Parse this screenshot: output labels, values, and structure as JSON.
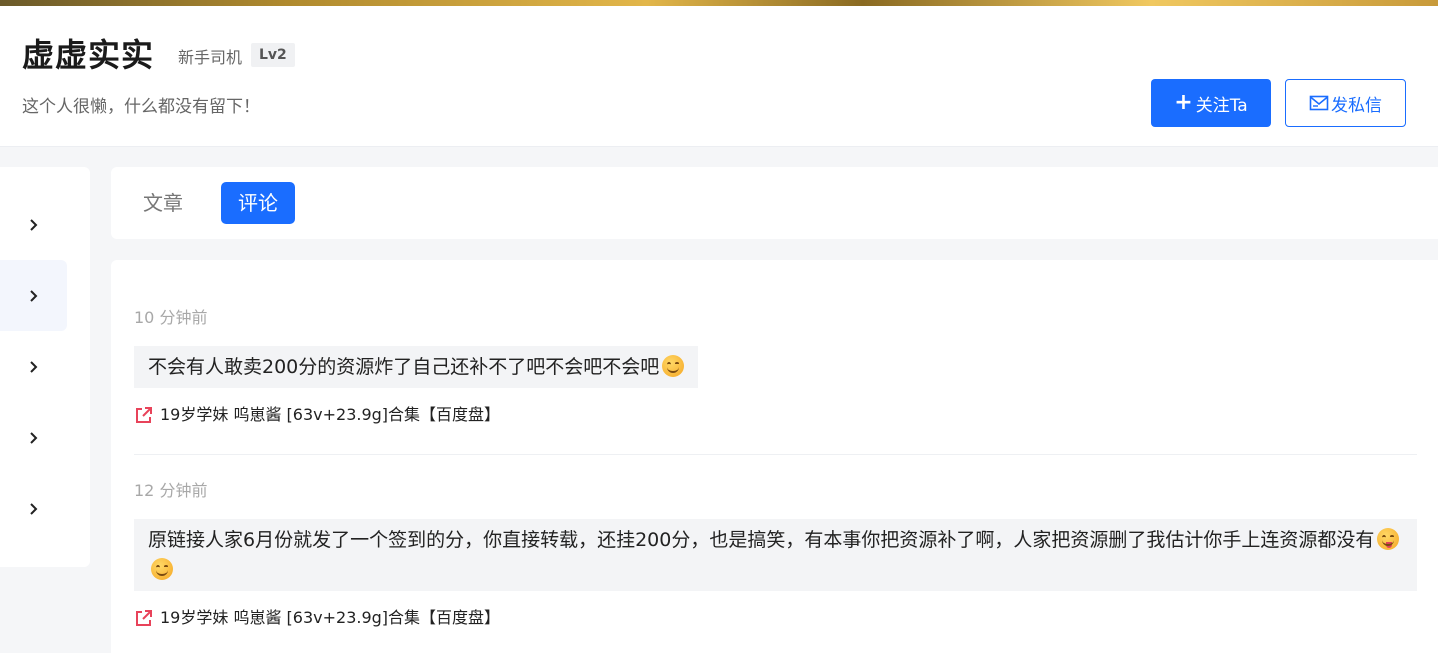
{
  "profile": {
    "name": "虚虚实实",
    "rank": "新手司机",
    "level": "Lv2",
    "bio": "这个人很懒，什么都没有留下！",
    "follow_label": "关注Ta",
    "message_label": "发私信"
  },
  "tabs": [
    {
      "label": "文章",
      "active": false
    },
    {
      "label": "评论",
      "active": true
    }
  ],
  "comments": [
    {
      "time": "10 分钟前",
      "text": "不会有人敢卖200分的资源炸了自己还补不了吧不会吧不会吧",
      "emojis": [
        "smile-emoji"
      ],
      "link": "19岁学妹 呜崽酱 [63v+23.9g]合集【百度盘】"
    },
    {
      "time": "12 分钟前",
      "text": "原链接人家6月份就发了一个签到的分，你直接转载，还挂200分，也是搞笑，有本事你把资源补了啊，人家把资源删了我估计你手上连资源都没有",
      "emojis": [
        "tongue-emoji",
        "smile-emoji"
      ],
      "link": "19岁学妹 呜崽酱 [63v+23.9g]合集【百度盘】"
    }
  ],
  "colors": {
    "accent": "#1a6dff",
    "link_icon": "#e8435a"
  }
}
